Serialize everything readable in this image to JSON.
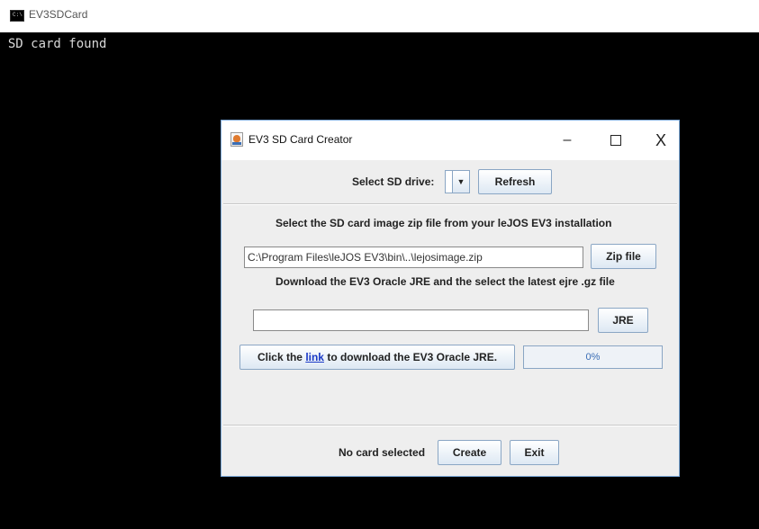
{
  "console": {
    "title": "EV3SDCard",
    "output": "o SD card found"
  },
  "dialog": {
    "title": "EV3 SD Card Creator",
    "controls": {
      "minimize": "–",
      "close": "X"
    },
    "select_drive_label": "Select SD drive:",
    "refresh_label": "Refresh",
    "zip_instruction": "Select the SD card image zip file from your leJOS EV3 installation",
    "zip_path": "C:\\Program Files\\leJOS EV3\\bin\\..\\lejosimage.zip",
    "zip_button": "Zip file",
    "jre_instruction": "Download the EV3 Oracle JRE and the select the latest ejre .gz file",
    "jre_path": "",
    "jre_button": "JRE",
    "download_prefix": "Click the ",
    "download_link": "link",
    "download_suffix": " to download the EV3 Oracle JRE.",
    "progress": "0%",
    "status": "No card selected",
    "create_button": "Create",
    "exit_button": "Exit"
  },
  "icons": [
    "console-icon",
    "java-cup-icon",
    "minimize-icon",
    "maximize-icon",
    "close-icon",
    "chevron-down-icon"
  ]
}
